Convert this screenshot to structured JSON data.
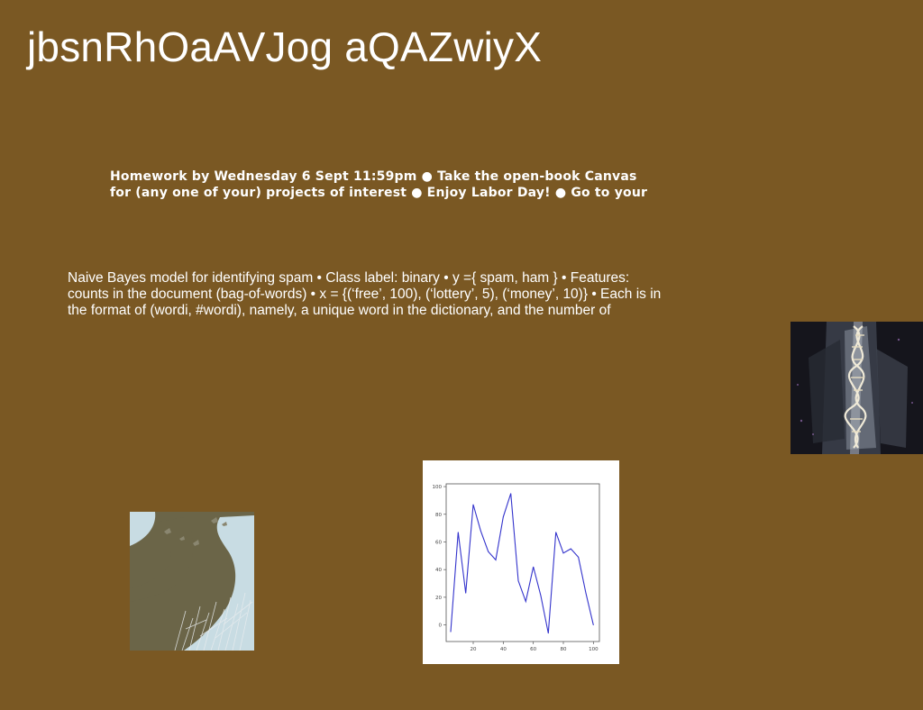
{
  "slide": {
    "title": "jbsnRhOaAVJog aQAZwiyX",
    "homework_text": "Homework by Wednesday 6 Sept 11:59pm ● Take the open-book Canvas for (any one of your) projects of interest ● Enjoy Labor Day! ● Go to your",
    "bayes_text": "Naive Bayes model for identifying spam • Class label: binary • y ={ spam, ham } • Features: counts in the document (bag-of-words) • x = {(‘free’, 100), (‘lottery’, 5), (‘money’, 10)} • Each is in the format of (wordi, #wordi), namely, a unique word in the dictionary, and the number of"
  },
  "colors": {
    "background": "#7a5823",
    "text": "#ffffff",
    "chart_line": "#3333cc"
  },
  "images": {
    "crystal": "dna-crystal-image",
    "silhouette": "bird-silhouette-image",
    "chart": "line-chart-image"
  },
  "chart_data": {
    "type": "line",
    "title": "",
    "xlabel": "",
    "ylabel": "",
    "xlim": [
      2,
      104
    ],
    "ylim": [
      -12,
      102
    ],
    "xticks": [
      20,
      40,
      60,
      80,
      100
    ],
    "yticks": [
      0,
      20,
      40,
      60,
      80,
      100
    ],
    "grid": false,
    "x": [
      5,
      10,
      15,
      20,
      25,
      30,
      35,
      40,
      45,
      50,
      55,
      60,
      65,
      70,
      75,
      80,
      85,
      90,
      95,
      100
    ],
    "y": [
      -5,
      67,
      23,
      87,
      68,
      53,
      47,
      78,
      95,
      32,
      17,
      42,
      21,
      -6,
      67,
      52,
      55,
      49,
      23,
      0
    ]
  }
}
